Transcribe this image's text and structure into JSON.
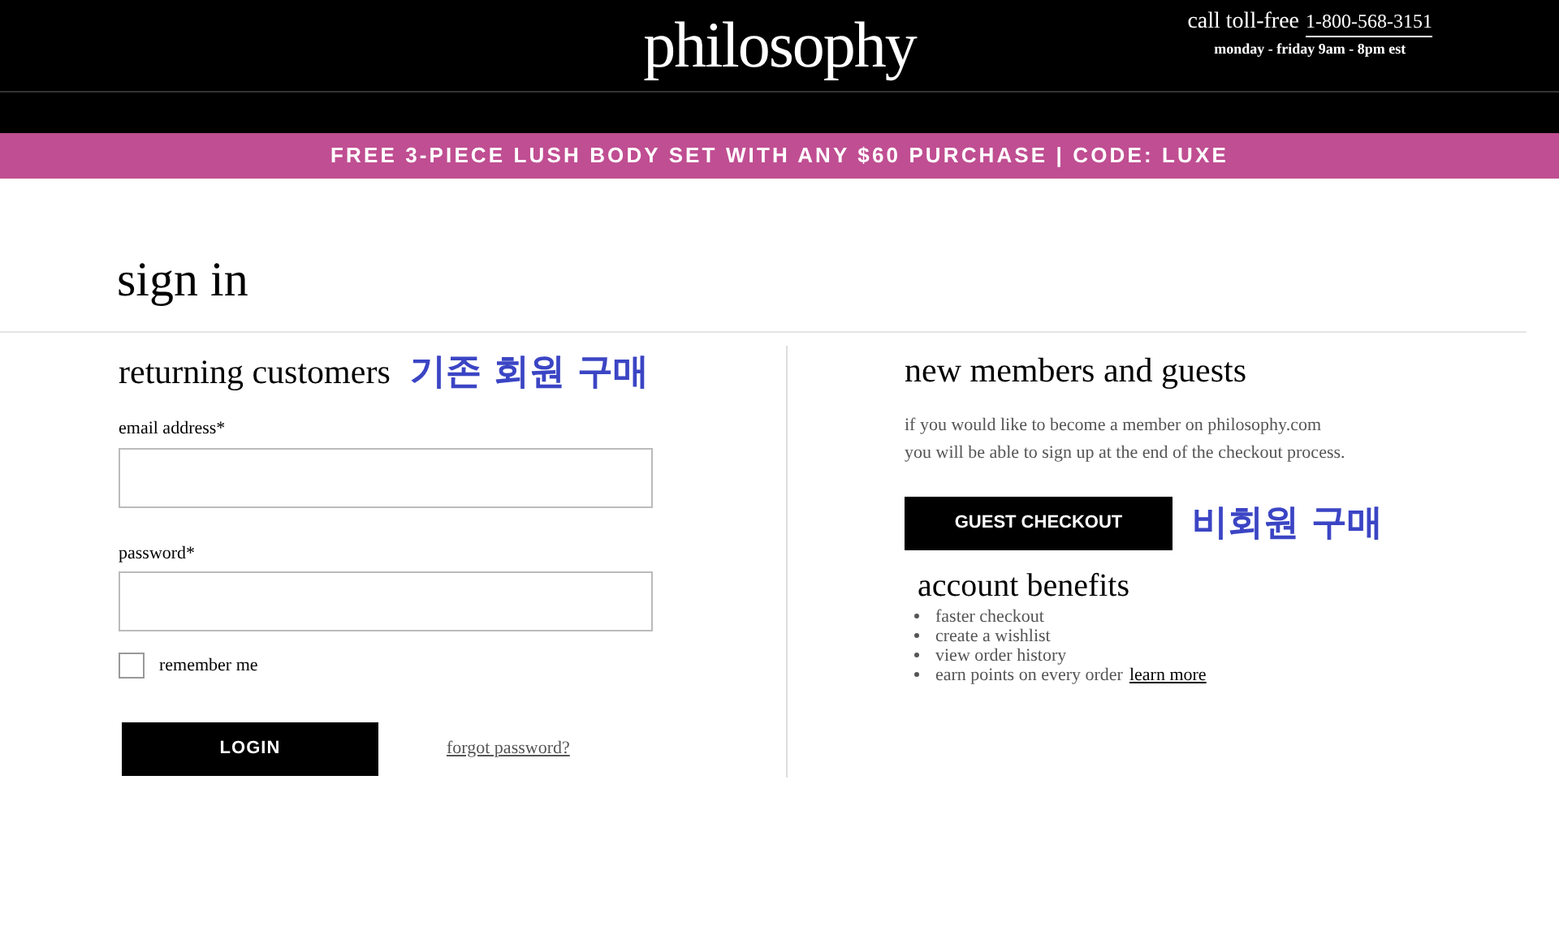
{
  "header": {
    "logo": "philosophy",
    "phone_label": "call toll-free",
    "phone": "1-800-568-3151",
    "hours": "monday - friday 9am - 8pm est"
  },
  "promo_banner": "FREE 3-PIECE LUSH BODY SET WITH ANY $60 PURCHASE | CODE: LUXE",
  "page_title": "sign in",
  "returning": {
    "title": "returning customers",
    "note": "기존 회원 구매",
    "email_label": "email address*",
    "password_label": "password*",
    "remember": {
      "label": "remember me",
      "checked": false
    },
    "login_button": "LOGIN",
    "forgot_link": "forgot password?"
  },
  "new_members": {
    "title": "new members and guests",
    "description": "if you would like to become a member on philosophy.com you will be able to sign up at the end of the checkout process.",
    "guest_button": "GUEST CHECKOUT",
    "note": "비회원 구매",
    "benefits_title": "account benefits",
    "benefits": [
      {
        "text": "faster checkout"
      },
      {
        "text": "create a wishlist"
      },
      {
        "text": "view order history"
      },
      {
        "text": "earn points on every order",
        "link": "learn more"
      }
    ]
  }
}
